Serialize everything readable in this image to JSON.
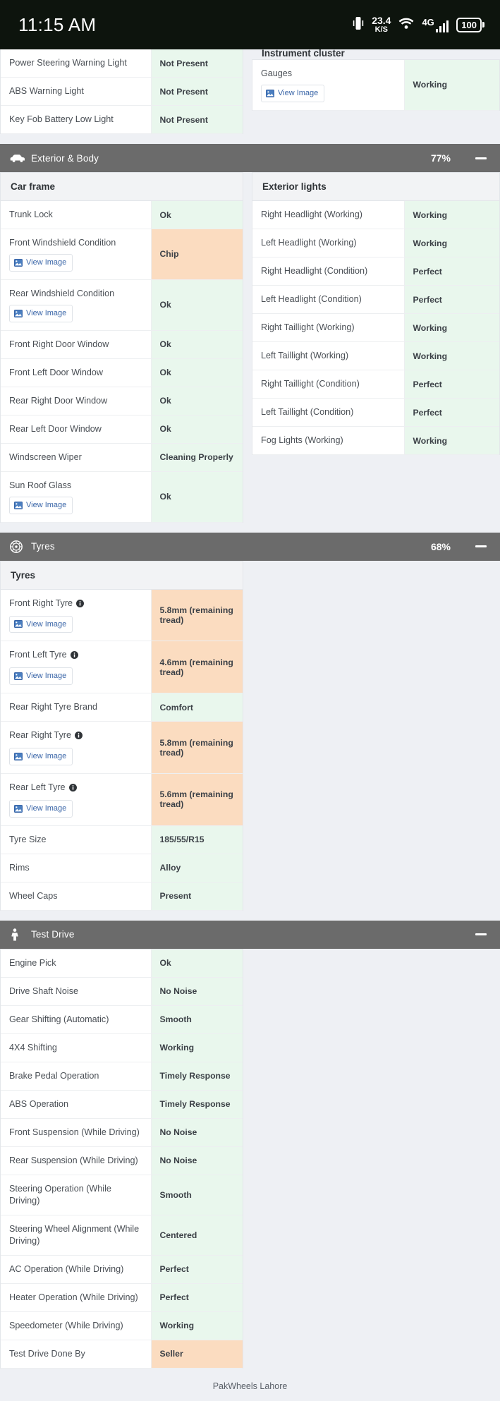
{
  "status_bar": {
    "time": "11:15 AM",
    "vibrate_icon": "vibrate-icon",
    "net_speed_value": "23.4",
    "net_speed_unit": "K/S",
    "wifi_icon": "wifi-icon",
    "network_type": "4G",
    "battery_level": "100"
  },
  "top_partial": {
    "left_rows": [
      {
        "label": "Power Steering Warning Light",
        "value": "Not Present",
        "state": "ok"
      },
      {
        "label": "ABS Warning Light",
        "value": "Not Present",
        "state": "ok"
      },
      {
        "label": "Key Fob Battery Low Light",
        "value": "Not Present",
        "state": "ok"
      }
    ],
    "right_title": "Instrument cluster",
    "right_rows": [
      {
        "label": "Gauges",
        "value": "Working",
        "state": "ok",
        "view_image": "View Image"
      }
    ]
  },
  "sections": [
    {
      "id": "exterior-body",
      "icon": "car-icon",
      "title": "Exterior & Body",
      "percent": "77%",
      "collapse_label": "collapse",
      "left": {
        "title": "Car frame",
        "rows": [
          {
            "label": "Trunk Lock",
            "value": "Ok",
            "state": "ok"
          },
          {
            "label": "Front Windshield Condition",
            "value": "Chip",
            "state": "warn",
            "view_image": "View Image"
          },
          {
            "label": "Rear Windshield Condition",
            "value": "Ok",
            "state": "ok",
            "view_image": "View Image"
          },
          {
            "label": "Front Right Door Window",
            "value": "Ok",
            "state": "ok"
          },
          {
            "label": "Front Left Door Window",
            "value": "Ok",
            "state": "ok"
          },
          {
            "label": "Rear Right Door Window",
            "value": "Ok",
            "state": "ok"
          },
          {
            "label": "Rear Left Door Window",
            "value": "Ok",
            "state": "ok"
          },
          {
            "label": "Windscreen Wiper",
            "value": "Cleaning Properly",
            "state": "ok"
          },
          {
            "label": "Sun Roof Glass",
            "value": "Ok",
            "state": "ok",
            "view_image": "View Image"
          }
        ]
      },
      "right": {
        "title": "Exterior lights",
        "rows": [
          {
            "label": "Right Headlight (Working)",
            "value": "Working",
            "state": "ok"
          },
          {
            "label": "Left Headlight (Working)",
            "value": "Working",
            "state": "ok"
          },
          {
            "label": "Right Headlight (Condition)",
            "value": "Perfect",
            "state": "ok"
          },
          {
            "label": "Left Headlight (Condition)",
            "value": "Perfect",
            "state": "ok"
          },
          {
            "label": "Right Taillight (Working)",
            "value": "Working",
            "state": "ok"
          },
          {
            "label": "Left Taillight (Working)",
            "value": "Working",
            "state": "ok"
          },
          {
            "label": "Right Taillight (Condition)",
            "value": "Perfect",
            "state": "ok"
          },
          {
            "label": "Left Taillight (Condition)",
            "value": "Perfect",
            "state": "ok"
          },
          {
            "label": "Fog Lights (Working)",
            "value": "Working",
            "state": "ok"
          }
        ]
      }
    },
    {
      "id": "tyres",
      "icon": "wheel-icon",
      "title": "Tyres",
      "percent": "68%",
      "collapse_label": "collapse",
      "left": {
        "title": "Tyres",
        "rows": [
          {
            "label": "Front Right Tyre",
            "value": "5.8mm (remaining tread)",
            "state": "warn",
            "view_image": "View Image",
            "info": true
          },
          {
            "label": "Front Left Tyre",
            "value": "4.6mm (remaining tread)",
            "state": "warn",
            "view_image": "View Image",
            "info": true
          },
          {
            "label": "Rear Right Tyre Brand",
            "value": "Comfort",
            "state": "ok"
          },
          {
            "label": "Rear Right Tyre",
            "value": "5.8mm (remaining tread)",
            "state": "warn",
            "view_image": "View Image",
            "info": true
          },
          {
            "label": "Rear Left Tyre",
            "value": "5.6mm (remaining tread)",
            "state": "warn",
            "view_image": "View Image",
            "info": true
          },
          {
            "label": "Tyre Size",
            "value": "185/55/R15",
            "state": "ok"
          },
          {
            "label": "Rims",
            "value": "Alloy",
            "state": "ok"
          },
          {
            "label": "Wheel Caps",
            "value": "Present",
            "state": "ok"
          }
        ]
      },
      "right": null
    },
    {
      "id": "test-drive",
      "icon": "test-drive-icon",
      "title": "Test Drive",
      "percent": "",
      "collapse_label": "collapse",
      "left": {
        "title": "",
        "rows": [
          {
            "label": "Engine Pick",
            "value": "Ok",
            "state": "ok"
          },
          {
            "label": "Drive Shaft Noise",
            "value": "No Noise",
            "state": "ok"
          },
          {
            "label": "Gear Shifting (Automatic)",
            "value": "Smooth",
            "state": "ok"
          },
          {
            "label": "4X4 Shifting",
            "value": "Working",
            "state": "ok"
          },
          {
            "label": "Brake Pedal Operation",
            "value": "Timely Response",
            "state": "ok"
          },
          {
            "label": "ABS Operation",
            "value": "Timely Response",
            "state": "ok"
          },
          {
            "label": "Front Suspension (While Driving)",
            "value": "No Noise",
            "state": "ok"
          },
          {
            "label": "Rear Suspension (While Driving)",
            "value": "No Noise",
            "state": "ok"
          },
          {
            "label": "Steering Operation (While Driving)",
            "value": "Smooth",
            "state": "ok"
          },
          {
            "label": "Steering Wheel Alignment (While Driving)",
            "value": "Centered",
            "state": "ok"
          },
          {
            "label": "AC Operation (While Driving)",
            "value": "Perfect",
            "state": "ok"
          },
          {
            "label": "Heater Operation (While Driving)",
            "value": "Perfect",
            "state": "ok"
          },
          {
            "label": "Speedometer (While Driving)",
            "value": "Working",
            "state": "ok"
          },
          {
            "label": "Test Drive Done By",
            "value": "Seller",
            "state": "warn"
          }
        ]
      },
      "right": null
    }
  ],
  "footer": {
    "text": "PakWheels Lahore"
  },
  "colors": {
    "status_bar_bg": "#0d140d",
    "section_header_bg": "#6b6b6b",
    "page_bg": "#eef0f4",
    "ok_bg": "#e9f7ed",
    "warn_bg": "#fbdcc0",
    "link": "#3a66a8"
  }
}
